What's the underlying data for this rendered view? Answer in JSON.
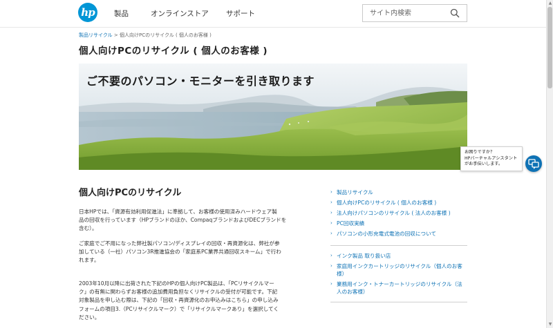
{
  "header": {
    "logo_text": "hp",
    "nav": [
      "製品",
      "オンラインストア",
      "サポート"
    ],
    "search_placeholder": "サイト内検索"
  },
  "breadcrumb": {
    "parent": "製品リサイクル",
    "separator": " > ",
    "current": "個人向けPCのリサイクル ( 個人のお客様 )"
  },
  "page_title": "個人向けPCのリサイクル ( 個人のお客様 )",
  "hero": {
    "headline": "ご不要のパソコン・モニターを引き取ります"
  },
  "main": {
    "section_title": "個人向けPCのリサイクル",
    "paragraphs": [
      [
        "日本HPでは、「資源有効利用促進法」に準拠して、お客様の使用済みハードウェア製",
        "品の回収を行っています（HPブランドのほか、Compaqブランドおよび​DECブランドを",
        "含む）。"
      ],
      [
        "ご家庭でご不用になった弊社製パソコン/ディスプレイの回収・再資源化は、弊社が参",
        "加している（一社）パソコン3R推進協会の「家庭系PC業界共通回収スキーム」で行わ",
        "れます。"
      ],
      [
        "2003年10月以降に出荷された下記のHPの個人向けPC製品は、「PCリサイクルマー",
        "ク」の有無に関わらずお客様の追加費用負担なくリサイクルの受付が可能です。下記",
        "対象製品を申し込む際は、下記の「回収・再資源化のお申込みはこちら」の申し込み",
        "フォームの項目3.（PCリサイクルマーク）で「リサイクルマークあり」を選択してく",
        "ださい。"
      ]
    ]
  },
  "sidebar": {
    "group1": [
      "製品リサイクル",
      "個人向けPCのリサイクル ( 個人のお客様 )",
      "法人向けパソコンのリサイクル ( 法人のお客様 )",
      "PC回収実績",
      "パソコンの小形充電式電池の回収について"
    ],
    "group2": [
      [
        "インク製品 取り扱い店"
      ],
      [
        "家庭用インクカートリッジのリサイクル（個人のお客",
        "様）"
      ],
      [
        "業務用インク・トナーカートリッジのリサイクル（法",
        "人のお客様）"
      ]
    ]
  },
  "assistant": {
    "lines": [
      "お困りですか？",
      "HPバーチャルアシスタント",
      "がお手伝いします。"
    ]
  },
  "colors": {
    "brand": "#0096d6",
    "link": "#0e72b5",
    "text": "#333333"
  },
  "icons": {
    "search": "search-icon",
    "chat": "chat-icon",
    "arrow": "arrow-right-icon"
  }
}
